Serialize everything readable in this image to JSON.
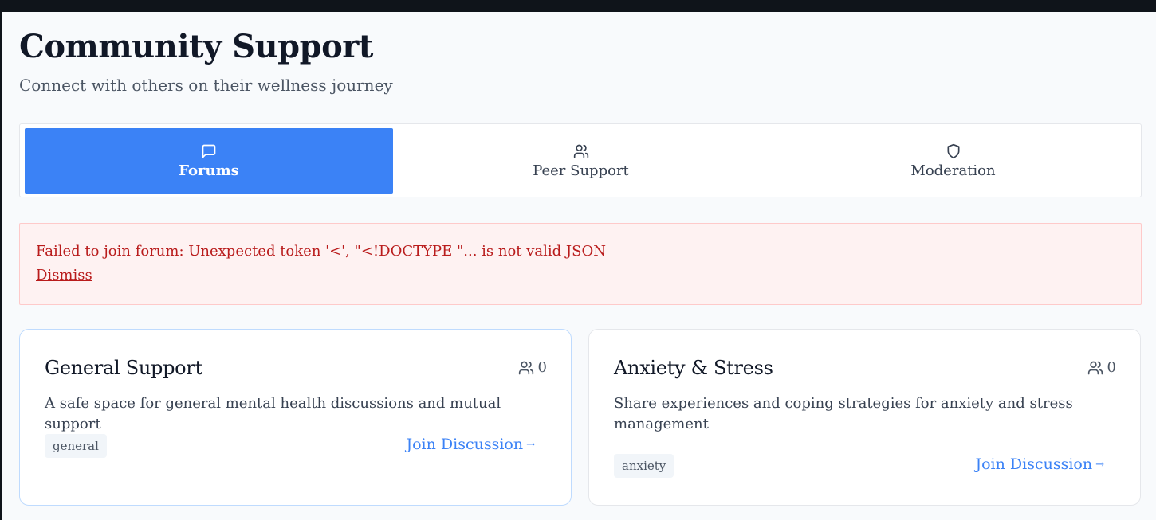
{
  "header": {
    "title": "Community Support",
    "subtitle": "Connect with others on their wellness journey"
  },
  "tabs": [
    {
      "label": "Forums",
      "icon": "message-square-icon",
      "active": true
    },
    {
      "label": "Peer Support",
      "icon": "users-icon",
      "active": false
    },
    {
      "label": "Moderation",
      "icon": "shield-icon",
      "active": false
    }
  ],
  "alert": {
    "message": "Failed to join forum: Unexpected token '<', \"<!DOCTYPE \"... is not valid JSON",
    "dismiss_label": "Dismiss"
  },
  "forums": [
    {
      "title": "General Support",
      "members": "0",
      "description": "A safe space for general mental health discussions and mutual support",
      "tag": "general",
      "join_label": "Join Discussion"
    },
    {
      "title": "Anxiety & Stress",
      "members": "0",
      "description": "Share experiences and coping strategies for anxiety and stress management",
      "tag": "anxiety",
      "join_label": "Join Discussion"
    }
  ],
  "colors": {
    "accent": "#3b82f6",
    "error_text": "#b91c1c",
    "error_bg": "#fef2f2"
  }
}
